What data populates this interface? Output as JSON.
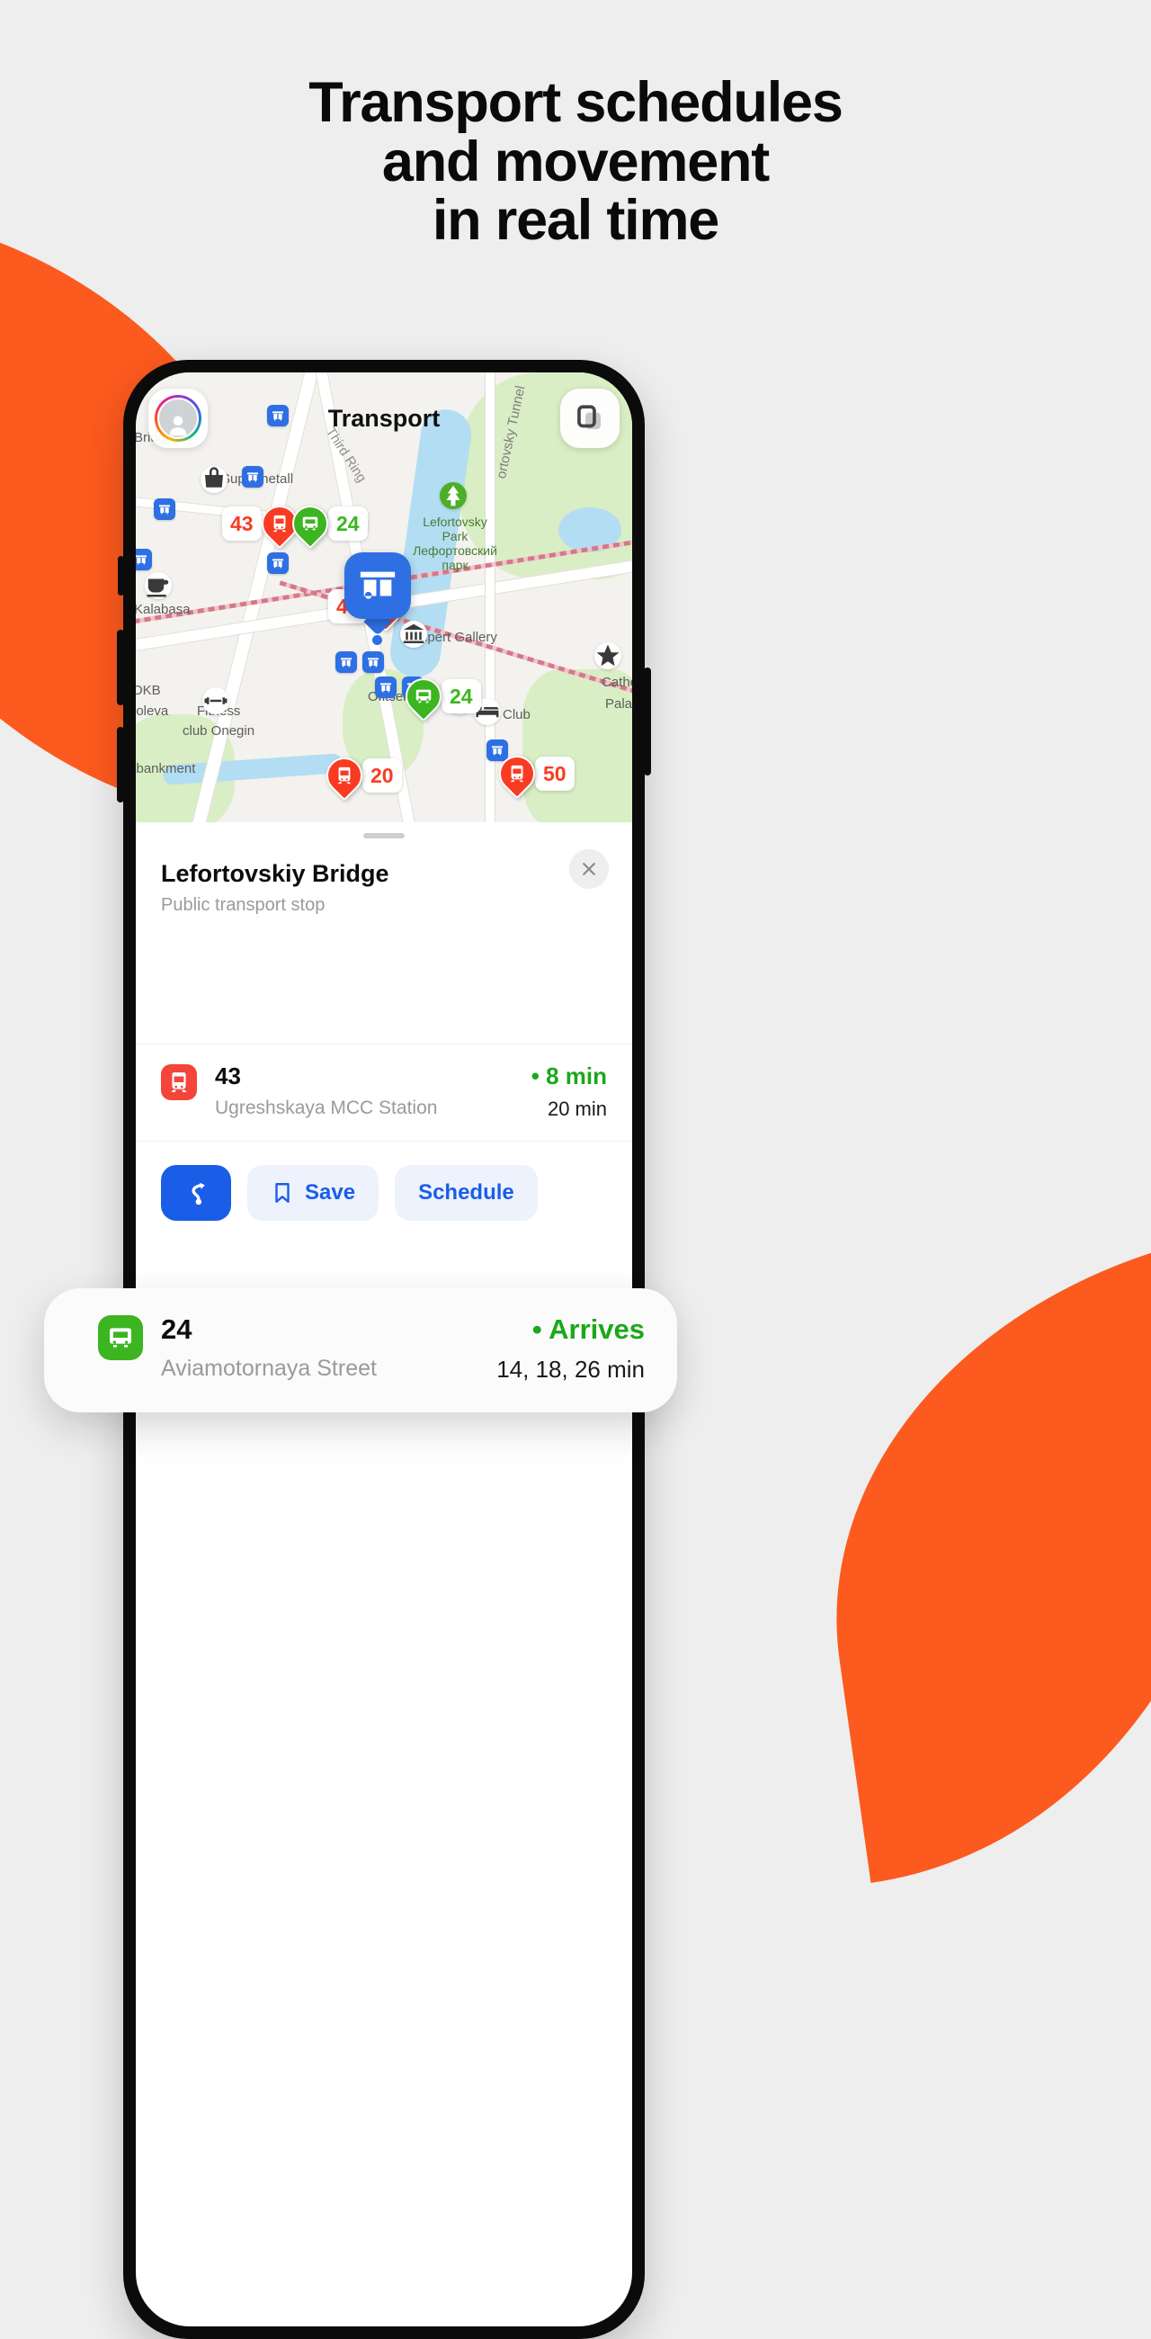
{
  "headline": {
    "line1": "Transport schedules",
    "line2": "and movement",
    "line3": "in real time"
  },
  "colors": {
    "accent_orange": "#FC5A1E",
    "page_bg": "#EEEEEE",
    "brand_blue": "#1A5EE8",
    "bus_green": "#3CB521",
    "tram_red": "#F5453A",
    "arrive_green": "#1AA81A",
    "map_pin_blue": "#2F6FE4"
  },
  "map": {
    "title": "Transport",
    "avatar_icon": "user-avatar-icon",
    "layers_icon": "map-layers-icon",
    "labels": [
      {
        "text": "Bridge",
        "class": "dark"
      },
      {
        "text": "Supermetall",
        "class": "dark"
      },
      {
        "text": "Kalabasa",
        "class": "dark"
      },
      {
        "text": "OKB",
        "class": "dark"
      },
      {
        "text": "poleva",
        "class": "dark"
      },
      {
        "text": "Fitness",
        "class": "dark"
      },
      {
        "text": "club Onegin",
        "class": "dark"
      },
      {
        "text": "mbankment",
        "class": "dark"
      },
      {
        "text": "Alpert Gallery",
        "class": "dark"
      },
      {
        "text": "Ofitserskoye",
        "class": "dark"
      },
      {
        "text": "Club",
        "class": "dark"
      },
      {
        "text": "Cathe",
        "class": "dark"
      },
      {
        "text": "Pala",
        "class": "dark"
      },
      {
        "text": "Third Ring",
        "class": "road"
      },
      {
        "text": "ortovsky Tunnel",
        "class": "road"
      }
    ],
    "park_label": {
      "line1": "Lefortovsky",
      "line2": "Park",
      "line3": "Лефортовский",
      "line4": "парк"
    },
    "vehicles": [
      {
        "number": "43",
        "type": "tram",
        "color": "red",
        "label_side": "left"
      },
      {
        "number": "24",
        "type": "bus",
        "color": "green",
        "label_side": "right"
      },
      {
        "number": "43",
        "type": "tram",
        "color": "red",
        "label_side": "left"
      },
      {
        "number": "24",
        "type": "bus",
        "color": "green",
        "label_side": "right"
      },
      {
        "number": "20",
        "type": "tram",
        "color": "red",
        "label_side": "right"
      },
      {
        "number": "50",
        "type": "tram",
        "color": "red",
        "label_side": "right"
      }
    ],
    "selected_stop_icon": "transport-stop-pin-icon"
  },
  "sheet": {
    "title": "Lefortovskiy Bridge",
    "subtitle": "Public transport stop",
    "close_icon": "close-icon",
    "grabber": "drag-handle"
  },
  "routes": [
    {
      "number": "24",
      "destination": "Aviamotornaya Street",
      "type": "bus",
      "status": "• Arrives",
      "times": "14, 18, 26 min",
      "highlighted": true
    },
    {
      "number": "43",
      "destination": "Ugreshskaya MCC Station",
      "type": "tram",
      "status": "• 8 min",
      "times": "20 min",
      "highlighted": false
    }
  ],
  "actions": {
    "route_icon": "route-directions-icon",
    "save_icon": "bookmark-icon",
    "save_label": "Save",
    "schedule_label": "Schedule"
  }
}
